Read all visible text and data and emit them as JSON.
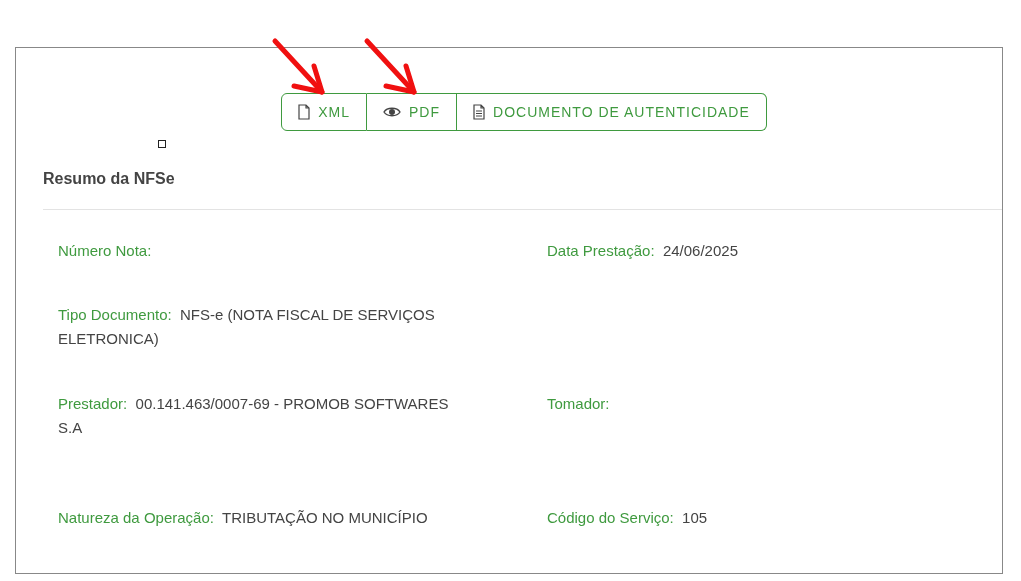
{
  "buttons": [
    {
      "label": "XML",
      "kind": "file"
    },
    {
      "label": "PDF",
      "kind": "preview"
    },
    {
      "label": "DOCUMENTO DE AUTENTICIDADE",
      "kind": "document"
    }
  ],
  "section_title": "Resumo da NFSe",
  "rows": [
    {
      "left": {
        "label": "Número Nota:"
      },
      "right": {
        "label": "Data Prestação:",
        "value": "24/06/2025"
      }
    },
    {
      "left": {
        "label": "Tipo Documento:",
        "value": "NFS-e (NOTA FISCAL DE SERVIÇOS ELETRONICA)"
      }
    },
    {
      "left": {
        "label": "Prestador:",
        "value": "00.141.463/0007-69 - PROMOB SOFTWARES S.A"
      },
      "right": {
        "label": "Tomador:"
      }
    },
    {
      "left": {
        "label": "Natureza da Operação:",
        "value": "TRIBUTAÇÃO NO MUNICÍPIO"
      },
      "right": {
        "label": "Código do Serviço:",
        "value": "105"
      }
    }
  ]
}
